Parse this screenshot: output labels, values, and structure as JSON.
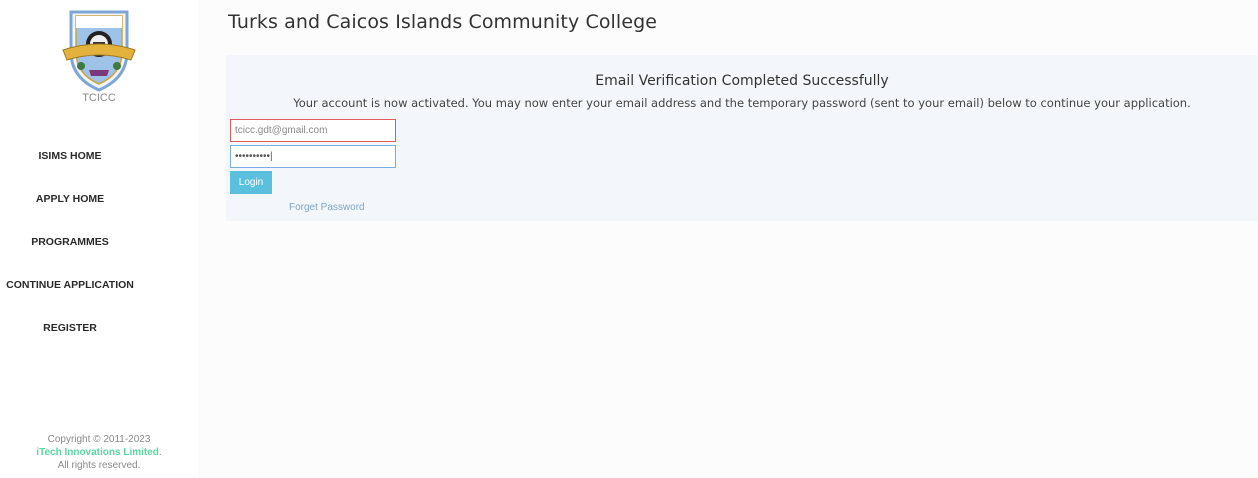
{
  "sidebar": {
    "logo_caption": "TCICC",
    "nav": [
      {
        "label": "ISIMS HOME"
      },
      {
        "label": "APPLY HOME"
      },
      {
        "label": "PROGRAMMES"
      },
      {
        "label": "CONTINUE APPLICATION"
      },
      {
        "label": "REGISTER"
      }
    ],
    "footer": {
      "copyright": "Copyright © 2011-2023",
      "brand": "iTech Innovations Limited",
      "brand_suffix": ".",
      "rights": "All rights reserved."
    }
  },
  "header": {
    "title": "Turks and Caicos Islands Community College"
  },
  "verification": {
    "title": "Email Verification Completed Successfully",
    "message": "Your account is now activated. You may now enter your email address and the temporary password (sent to your email) below to continue your application."
  },
  "login": {
    "email_value": "tcicc.gdt@gmail.com",
    "password_masked": "••••••••••|",
    "login_label": "Login",
    "forget_label": "Forget Password"
  },
  "colors": {
    "panel_bg": "#f3f7fb",
    "login_button": "#5bc0de",
    "email_border_error": "#e05a5a",
    "password_border_focus": "#78aee0",
    "footer_brand": "#5cd6a0"
  }
}
